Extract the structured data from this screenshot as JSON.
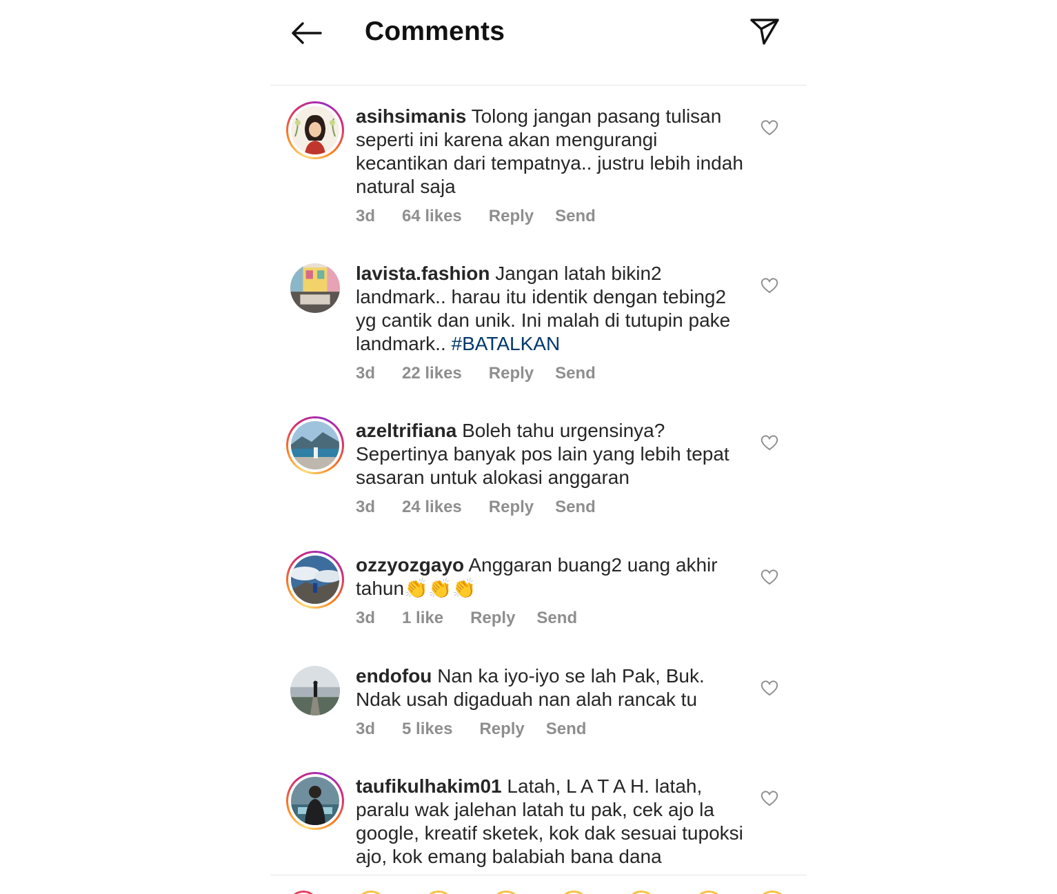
{
  "header": {
    "title": "Comments",
    "back_icon": "arrow-left-icon",
    "share_icon": "paper-plane-icon"
  },
  "comments": [
    {
      "username": "asihsimanis",
      "text": "Tolong jangan pasang tulisan seperti ini karena akan mengurangi kecantikan dari tempatnya.. justru lebih indah natural saja",
      "hashtag": "",
      "time": "3d",
      "likes": "64 likes",
      "reply": "Reply",
      "send": "Send"
    },
    {
      "username": "lavista.fashion",
      "text": "Jangan latah bikin2 landmark.. harau itu identik dengan tebing2 yg cantik dan unik. Ini malah di tutupin pake landmark..",
      "hashtag": "#BATALKAN",
      "time": "3d",
      "likes": "22 likes",
      "reply": "Reply",
      "send": "Send"
    },
    {
      "username": "azeltrifiana",
      "text": "Boleh tahu urgensinya? Sepertinya banyak pos lain yang lebih tepat sasaran untuk alokasi anggaran",
      "hashtag": "",
      "time": "3d",
      "likes": "24 likes",
      "reply": "Reply",
      "send": "Send"
    },
    {
      "username": "ozzyozgayo",
      "text": "Anggaran buang2 uang akhir tahun👏👏👏",
      "hashtag": "",
      "time": "3d",
      "likes": "1 like",
      "reply": "Reply",
      "send": "Send"
    },
    {
      "username": "endofou",
      "text": "Nan ka iyo-iyo se lah Pak, Buk. Ndak usah digaduah nan alah rancak tu",
      "hashtag": "",
      "time": "3d",
      "likes": "5 likes",
      "reply": "Reply",
      "send": "Send"
    },
    {
      "username": "taufikulhakim01",
      "text": "Latah, L A T A H. latah, paralu wak jalehan latah tu pak, cek ajo la google, kreatif sketek, kok dak sesuai tupoksi ajo, kok emang balabiah bana dana",
      "hashtag": "",
      "time": "",
      "likes": "",
      "reply": "",
      "send": ""
    }
  ],
  "colors": {
    "text": "#262626",
    "meta": "#8e8e8e",
    "hashtag": "#00376b",
    "divider": "#e6e6e6"
  }
}
